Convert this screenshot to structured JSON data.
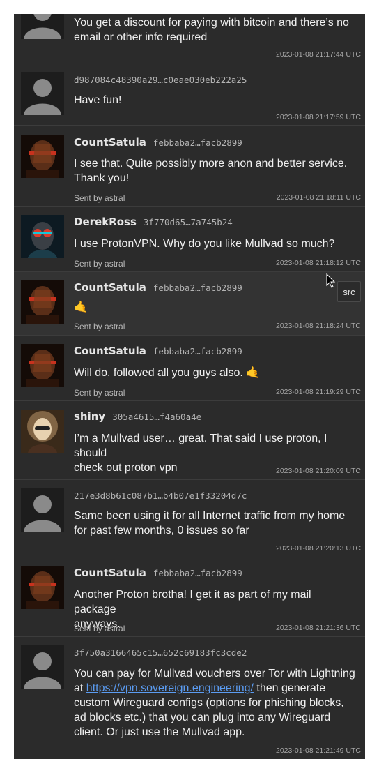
{
  "messages": [
    {
      "text_lines": [
        "You get a discount for paying with bitcoin and there’s no",
        "email or other info required"
      ],
      "time": "2023-01-08 21:17:44 UTC"
    },
    {
      "pubkey": "d987084c48390a29…c0eae030eb222a25",
      "text": "Have fun!",
      "time": "2023-01-08 21:17:59 UTC"
    },
    {
      "name": "CountSatula",
      "pubkey": "febbaba2…facb2899",
      "text_lines": [
        "I see that. Quite possibly more anon and better service.",
        "Thank you!"
      ],
      "sent_by": "Sent by astral",
      "time": "2023-01-08 21:18:11 UTC"
    },
    {
      "name": "DerekRoss",
      "pubkey": "3f770d65…7a745b24",
      "text": "I use ProtonVPN. Why do you like Mullvad so much?",
      "sent_by": "Sent by astral",
      "time": "2023-01-08 21:18:12 UTC"
    },
    {
      "name": "CountSatula",
      "pubkey": "febbaba2…facb2899",
      "text": "🤙",
      "sent_by": "Sent by astral",
      "time": "2023-01-08 21:18:24 UTC"
    },
    {
      "name": "CountSatula",
      "pubkey": "febbaba2…facb2899",
      "text": "Will do. followed all you guys also. 🤙",
      "sent_by": "Sent by astral",
      "time": "2023-01-08 21:19:29 UTC"
    },
    {
      "name": "shiny",
      "pubkey": "305a4615…f4a60a4e",
      "text_lines": [
        "I’m a Mullvad user… great. That said I use proton, I should",
        "check out proton vpn"
      ],
      "time": "2023-01-08 21:20:09 UTC"
    },
    {
      "pubkey": "217e3d8b61c087b1…b4b07e1f33204d7c",
      "text_lines": [
        "Same been using it for all Internet traffic from my home",
        "for past few months, 0 issues so far"
      ],
      "time": "2023-01-08 21:20:13 UTC"
    },
    {
      "name": "CountSatula",
      "pubkey": "febbaba2…facb2899",
      "text_lines": [
        "Another Proton brotha! I get it as part of my mail package",
        "anyways."
      ],
      "sent_by": "Sent by astral",
      "time": "2023-01-08 21:21:36 UTC"
    },
    {
      "pubkey": "3f750a3166465c15…652c69183fc3cde2",
      "text_line1_prefix": "You can pay for Mullvad vouchers over Tor with Lightning",
      "text_line2_prefix": "at ",
      "link": "https://vpn.sovereign.engineering/",
      "text_line2_suffix": " then generate",
      "text_rest": [
        "custom Wireguard configs (options for phishing blocks,",
        "ad blocks etc.) that you can plug into any Wireguard",
        "client. Or just use the Mullvad app."
      ],
      "time": "2023-01-08 21:21:49 UTC"
    }
  ],
  "hover_button": "src",
  "colors": {
    "panel": "#2b2b2b",
    "link": "#5b9cf2",
    "divider": "#3c3c3c"
  }
}
